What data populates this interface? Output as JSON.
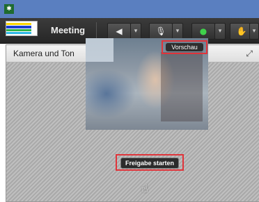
{
  "app_icon_symbol": "✱",
  "toolbar": {
    "meeting_label": "Meeting",
    "buttons": [
      {
        "name": "speaker-icon",
        "symbol": "◀"
      },
      {
        "name": "microphone-icon",
        "symbol": "🎙"
      },
      {
        "name": "webcam-icon",
        "symbol": "●"
      },
      {
        "name": "raise-hand-icon",
        "symbol": "✋"
      }
    ],
    "caret": "▾"
  },
  "pod": {
    "title": "Kamera und Ton",
    "expand_symbol": "⤢"
  },
  "video": {
    "preview_label": "Vorschau",
    "start_label": "Freigabe starten"
  },
  "colors": {
    "highlight": "#e0343a",
    "top_strip": "#5a7fc0"
  }
}
